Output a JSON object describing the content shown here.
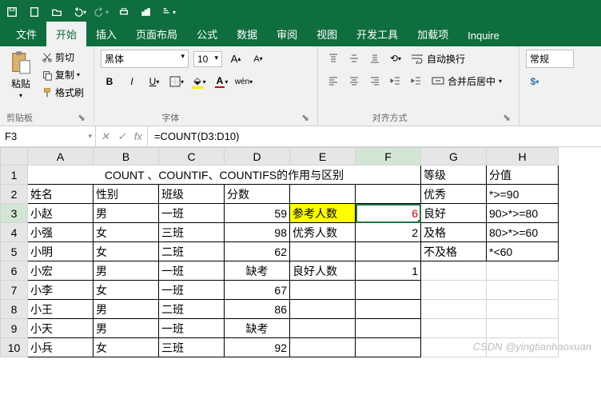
{
  "qat": {
    "save": "save",
    "new": "new",
    "open": "open",
    "undo": "undo",
    "redo": "redo",
    "print": "print",
    "chart": "chart",
    "sort": "sort"
  },
  "tabs": {
    "file": "文件",
    "home": "开始",
    "insert": "插入",
    "layout": "页面布局",
    "formulas": "公式",
    "data": "数据",
    "review": "审阅",
    "view": "视图",
    "dev": "开发工具",
    "addins": "加载项",
    "inquire": "Inquire"
  },
  "ribbon": {
    "clipboard": {
      "paste": "粘贴",
      "cut": "剪切",
      "copy": "复制",
      "format_painter": "格式刷",
      "label": "剪贴板"
    },
    "font": {
      "name": "黑体",
      "size": "10",
      "label": "字体",
      "wen": "wén"
    },
    "align": {
      "wrap": "自动换行",
      "merge": "合并后居中",
      "label": "对齐方式"
    },
    "number": {
      "general": "常规",
      "currency_icon": "$"
    }
  },
  "fbar": {
    "cellref": "F3",
    "formula": "=COUNT(D3:D10)"
  },
  "columns": [
    "A",
    "B",
    "C",
    "D",
    "E",
    "F",
    "G",
    "H"
  ],
  "sheet": {
    "title_merged": "COUNT 、COUNTIF、COUNTIFS的作用与区别",
    "headers": {
      "A": "姓名",
      "B": "性别",
      "C": "班级",
      "D": "分数"
    },
    "rows": [
      {
        "A": "小赵",
        "B": "男",
        "C": "一班",
        "D": "59",
        "E": "参考人数",
        "F": "6"
      },
      {
        "A": "小强",
        "B": "女",
        "C": "三班",
        "D": "98",
        "E": "优秀人数",
        "F": "2"
      },
      {
        "A": "小明",
        "B": "女",
        "C": "二班",
        "D": "62",
        "E": "",
        "F": ""
      },
      {
        "A": "小宏",
        "B": "男",
        "C": "一班",
        "D": "缺考",
        "E": "良好人数",
        "F": "1"
      },
      {
        "A": "小李",
        "B": "女",
        "C": "一班",
        "D": "67",
        "E": "",
        "F": ""
      },
      {
        "A": "小王",
        "B": "男",
        "C": "二班",
        "D": "86",
        "E": "",
        "F": ""
      },
      {
        "A": "小天",
        "B": "男",
        "C": "一班",
        "D": "缺考",
        "E": "",
        "F": ""
      },
      {
        "A": "小兵",
        "B": "女",
        "C": "三班",
        "D": "92",
        "E": "",
        "F": ""
      }
    ],
    "side": {
      "g1": "等级",
      "h1": "分值",
      "g2": "优秀",
      "h2": "*>=90",
      "g3": "良好",
      "h3": "90>*>=80",
      "g4": "及格",
      "h4": "80>*>=60",
      "g5": "不及格",
      "h5": "*<60"
    }
  },
  "watermark": "CSDN @yingtianhaoxuan"
}
